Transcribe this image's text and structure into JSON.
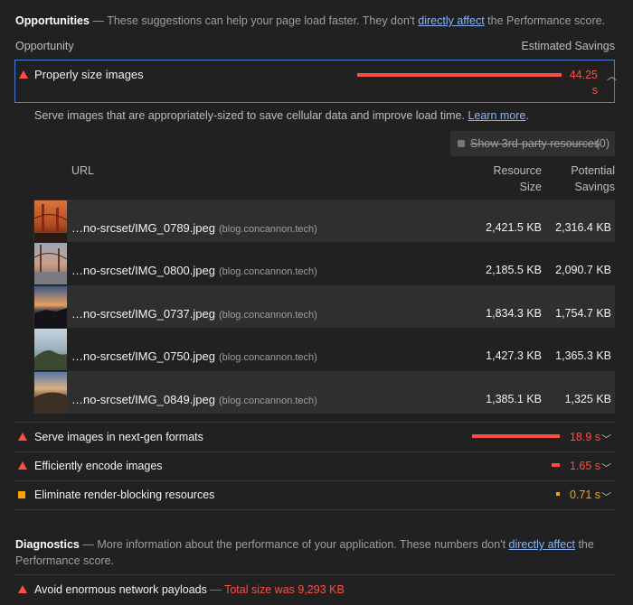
{
  "opportunities": {
    "heading": "Opportunities",
    "dash": "—",
    "intro": "These suggestions can help your page load faster. They don't",
    "link": "directly affect",
    "outro": "the Performance score.",
    "col_opportunity": "Opportunity",
    "col_savings": "Estimated Savings"
  },
  "selected": {
    "title": "Properly size images",
    "savings_value": "44.25",
    "savings_unit": "s",
    "savings_bar_fraction": 1.0,
    "description": "Serve images that are appropriately-sized to save cellular data and improve load time.",
    "learn_more": "Learn more",
    "period": ".",
    "third_party_label": "Show 3rd-party resources",
    "third_party_count": "(0)",
    "table_headers": {
      "url": "URL",
      "resource_line1": "Resource",
      "resource_line2": "Size",
      "potential_line1": "Potential",
      "potential_line2": "Savings"
    },
    "rows": [
      {
        "url": "…no-srcset/IMG_0789.jpeg",
        "host": "(blog.concannon.tech)",
        "size": "2,421.5 KB",
        "savings": "2,316.4 KB"
      },
      {
        "url": "…no-srcset/IMG_0800.jpeg",
        "host": "(blog.concannon.tech)",
        "size": "2,185.5 KB",
        "savings": "2,090.7 KB"
      },
      {
        "url": "…no-srcset/IMG_0737.jpeg",
        "host": "(blog.concannon.tech)",
        "size": "1,834.3 KB",
        "savings": "1,754.7 KB"
      },
      {
        "url": "…no-srcset/IMG_0750.jpeg",
        "host": "(blog.concannon.tech)",
        "size": "1,427.3 KB",
        "savings": "1,365.3 KB"
      },
      {
        "url": "…no-srcset/IMG_0849.jpeg",
        "host": "(blog.concannon.tech)",
        "size": "1,385.1 KB",
        "savings": "1,325 KB"
      }
    ]
  },
  "other_opportunities": [
    {
      "title": "Serve images in next-gen formats",
      "savings": "18.9 s",
      "bar_fraction": 0.43,
      "severity": "fail"
    },
    {
      "title": "Efficiently encode images",
      "savings": "1.65 s",
      "bar_fraction": 0.04,
      "severity": "fail"
    },
    {
      "title": "Eliminate render-blocking resources",
      "savings": "0.71 s",
      "bar_fraction": 0.016,
      "severity": "average"
    }
  ],
  "diagnostics": {
    "heading": "Diagnostics",
    "dash": "—",
    "intro": "More information about the performance of your application. These numbers don't",
    "link": "directly affect",
    "outro": "the",
    "line2": "Performance score.",
    "items": [
      {
        "title": "Avoid enormous network payloads",
        "dash": "—",
        "detail": "Total size was 9,293 KB"
      }
    ]
  },
  "colors": {
    "fail": "#ff4e42",
    "average": "#ffa400",
    "link": "#8ab4f8",
    "selected_border": "#4a7bd4"
  }
}
